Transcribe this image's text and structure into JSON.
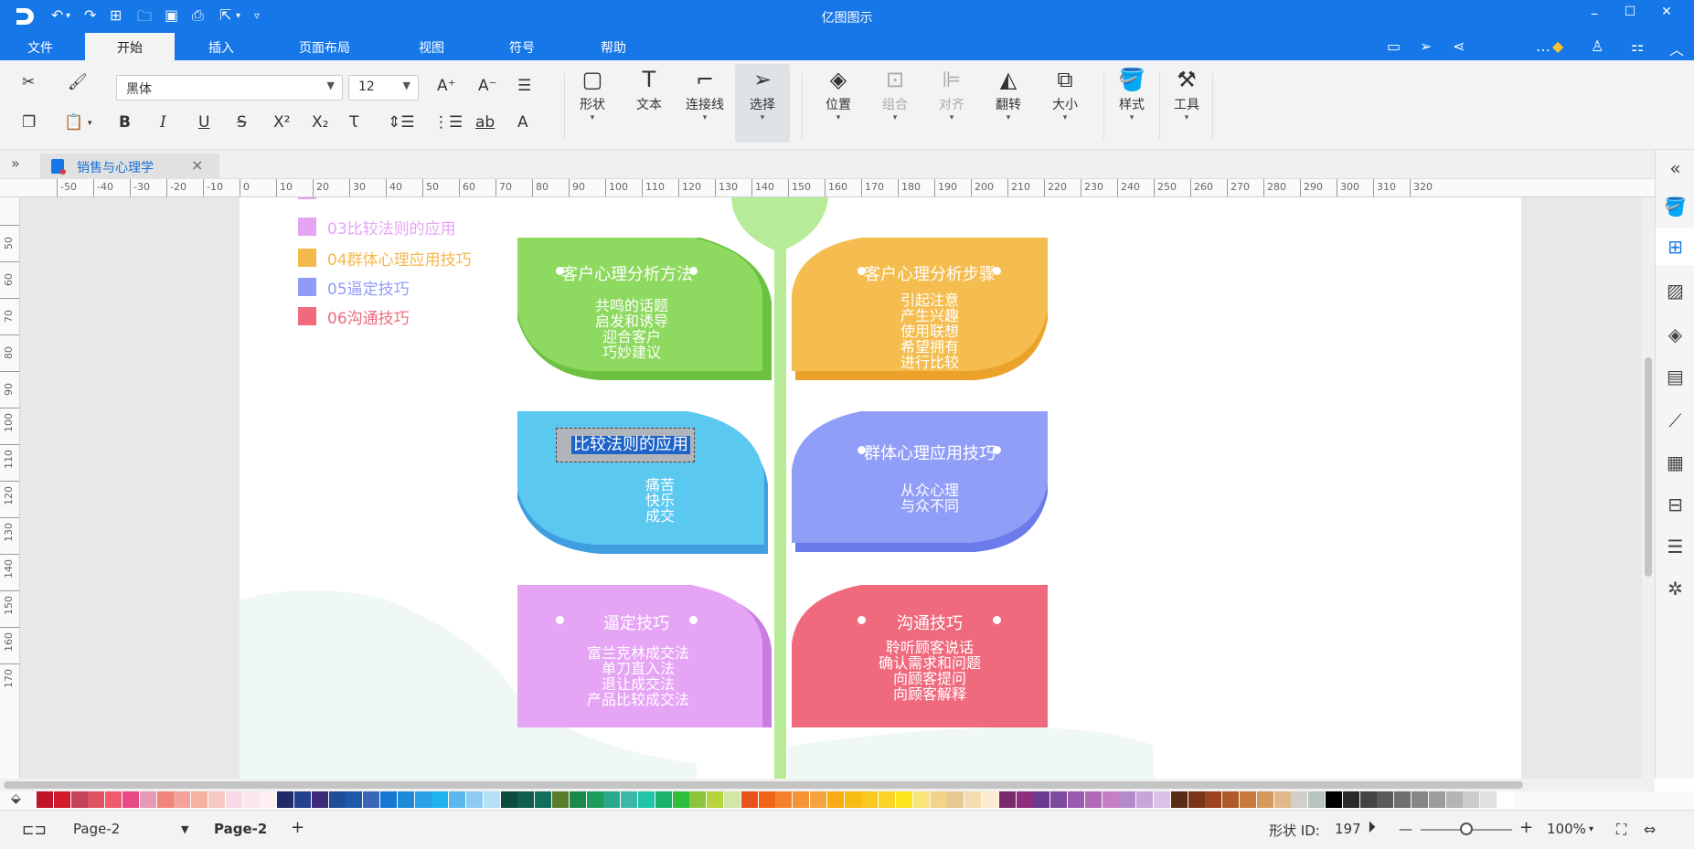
{
  "app": {
    "title": "亿图图示"
  },
  "window_controls": {
    "minimize": "–",
    "maximize": "☐",
    "close": "✕"
  },
  "menu": {
    "items": [
      "文件",
      "开始",
      "插入",
      "页面布局",
      "视图",
      "符号",
      "帮助"
    ],
    "active": "开始"
  },
  "ribbon": {
    "font_family": "黑体",
    "font_size": "12",
    "buttons": {
      "shape": "形状",
      "text": "文本",
      "connector": "连接线",
      "select": "选择",
      "position": "位置",
      "group": "组合",
      "align": "对齐",
      "flip": "翻转",
      "size": "大小",
      "style": "样式",
      "tools": "工具"
    }
  },
  "tab": {
    "document": "销售与心理学",
    "close": "×"
  },
  "ruler": {
    "h_labels": [
      "-50",
      "-40",
      "-30",
      "-20",
      "-10",
      "0",
      "10",
      "20",
      "30",
      "40",
      "50",
      "60",
      "70",
      "80",
      "90",
      "100",
      "110",
      "120",
      "130",
      "140",
      "150",
      "160",
      "170",
      "180",
      "190",
      "200",
      "210",
      "220",
      "230",
      "240",
      "250",
      "260",
      "270",
      "280",
      "290",
      "300",
      "310",
      "320"
    ],
    "v_labels": [
      "50",
      "60",
      "70",
      "80",
      "90",
      "100",
      "110",
      "120",
      "130",
      "140",
      "150",
      "160",
      "170"
    ]
  },
  "legend": [
    {
      "label": "03比较法则的应用",
      "color": "#e6a4f5"
    },
    {
      "label": "04群体心理应用技巧",
      "color": "#f5b84a"
    },
    {
      "label": "05逼定技巧",
      "color": "#8f9cf5"
    },
    {
      "label": "06沟通技巧",
      "color": "#f06a7e"
    }
  ],
  "leaves": {
    "analysis_method": {
      "title": "客户心理分析方法",
      "items": [
        "共鸣的话题",
        "启发和诱导",
        "迎合客户",
        "巧妙建议"
      ],
      "color": "#8ed95f",
      "shadow": "#6cc240"
    },
    "analysis_steps": {
      "title": "客户心理分析步骤",
      "items": [
        "引起注意",
        "产生兴趣",
        "使用联想",
        "希望拥有",
        "进行比较"
      ],
      "color": "#f5bd4f",
      "shadow": "#eaa22a"
    },
    "comparison": {
      "title": "比较法则的应用",
      "items": [
        "痛苦",
        "快乐",
        "成交"
      ],
      "color": "#5bc8f0",
      "shadow": "#3e9ee0"
    },
    "group_psychology": {
      "title": "群体心理应用技巧",
      "items": [
        "从众心理",
        "与众不同"
      ],
      "color": "#919ef7",
      "shadow": "#6b7bea"
    },
    "closing": {
      "title": "逼定技巧",
      "items": [
        "富兰克林成交法",
        "单刀直入法",
        "退让成交法",
        "产品比较成交法"
      ],
      "color": "#e6a4f5",
      "shadow": "#c97de0"
    },
    "communication": {
      "title": "沟通技巧",
      "items": [
        "聆听顾客说话",
        "确认需求和问题",
        "向顾客提问",
        "向顾客解释"
      ],
      "color": "#f06a7e",
      "shadow": "#d84560"
    }
  },
  "palette": [
    "#c0142a",
    "#d41b2c",
    "#c4435c",
    "#e05162",
    "#ef5a6f",
    "#e84a88",
    "#e59ab5",
    "#f0867a",
    "#f5a29a",
    "#f6b2a0",
    "#f8c9c2",
    "#f9d9e6",
    "#fae6ee",
    "#fdf0f3",
    "#1e2a6a",
    "#23408e",
    "#3d2b7a",
    "#1f4d9a",
    "#1a5aa8",
    "#3a66b8",
    "#1478d2",
    "#1c8ad8",
    "#2aa0e6",
    "#1fb4f0",
    "#5ab8ec",
    "#8fcbf0",
    "#b6e0f6",
    "#0c4a3e",
    "#0d5e4c",
    "#106e5c",
    "#5b7c2b",
    "#1a8a4a",
    "#1d9c5a",
    "#28aa8a",
    "#3ab8a8",
    "#20c4a6",
    "#19b36a",
    "#2bbf3c",
    "#8cc43c",
    "#b8d43c",
    "#d2e6a8",
    "#e8521c",
    "#f06418",
    "#f5822a",
    "#f79436",
    "#f5a33c",
    "#faac14",
    "#f9bc14",
    "#fac81e",
    "#fcd428",
    "#fde61e",
    "#f9e67a",
    "#f2d488",
    "#e8c892",
    "#f5dcb0",
    "#fbebd0",
    "#7a2a6a",
    "#8e2e7e",
    "#6a3a8e",
    "#7c4a9e",
    "#9a5aae",
    "#b06ab8",
    "#c47ec4",
    "#b48ac8",
    "#c8a4d8",
    "#dcc0e8",
    "#5a2a14",
    "#7a3418",
    "#9c4420",
    "#b05a2a",
    "#c87a3a",
    "#d49a5a",
    "#e2b88a",
    "#d0d0c8",
    "#b8c4c0",
    "#000000",
    "#2a2a2a",
    "#444444",
    "#5a5a5a",
    "#707070",
    "#868686",
    "#9c9c9c",
    "#b4b4b4",
    "#cccccc",
    "#e0e0e0",
    "#ffffff"
  ],
  "status": {
    "page_selector": "Page-2",
    "page_tab": "Page-2",
    "add": "+",
    "shape_id_label": "形状 ID:",
    "shape_id": "197",
    "zoom": "100%",
    "zoom_minus": "—",
    "zoom_plus": "+",
    "zoom_level": 0.5
  }
}
